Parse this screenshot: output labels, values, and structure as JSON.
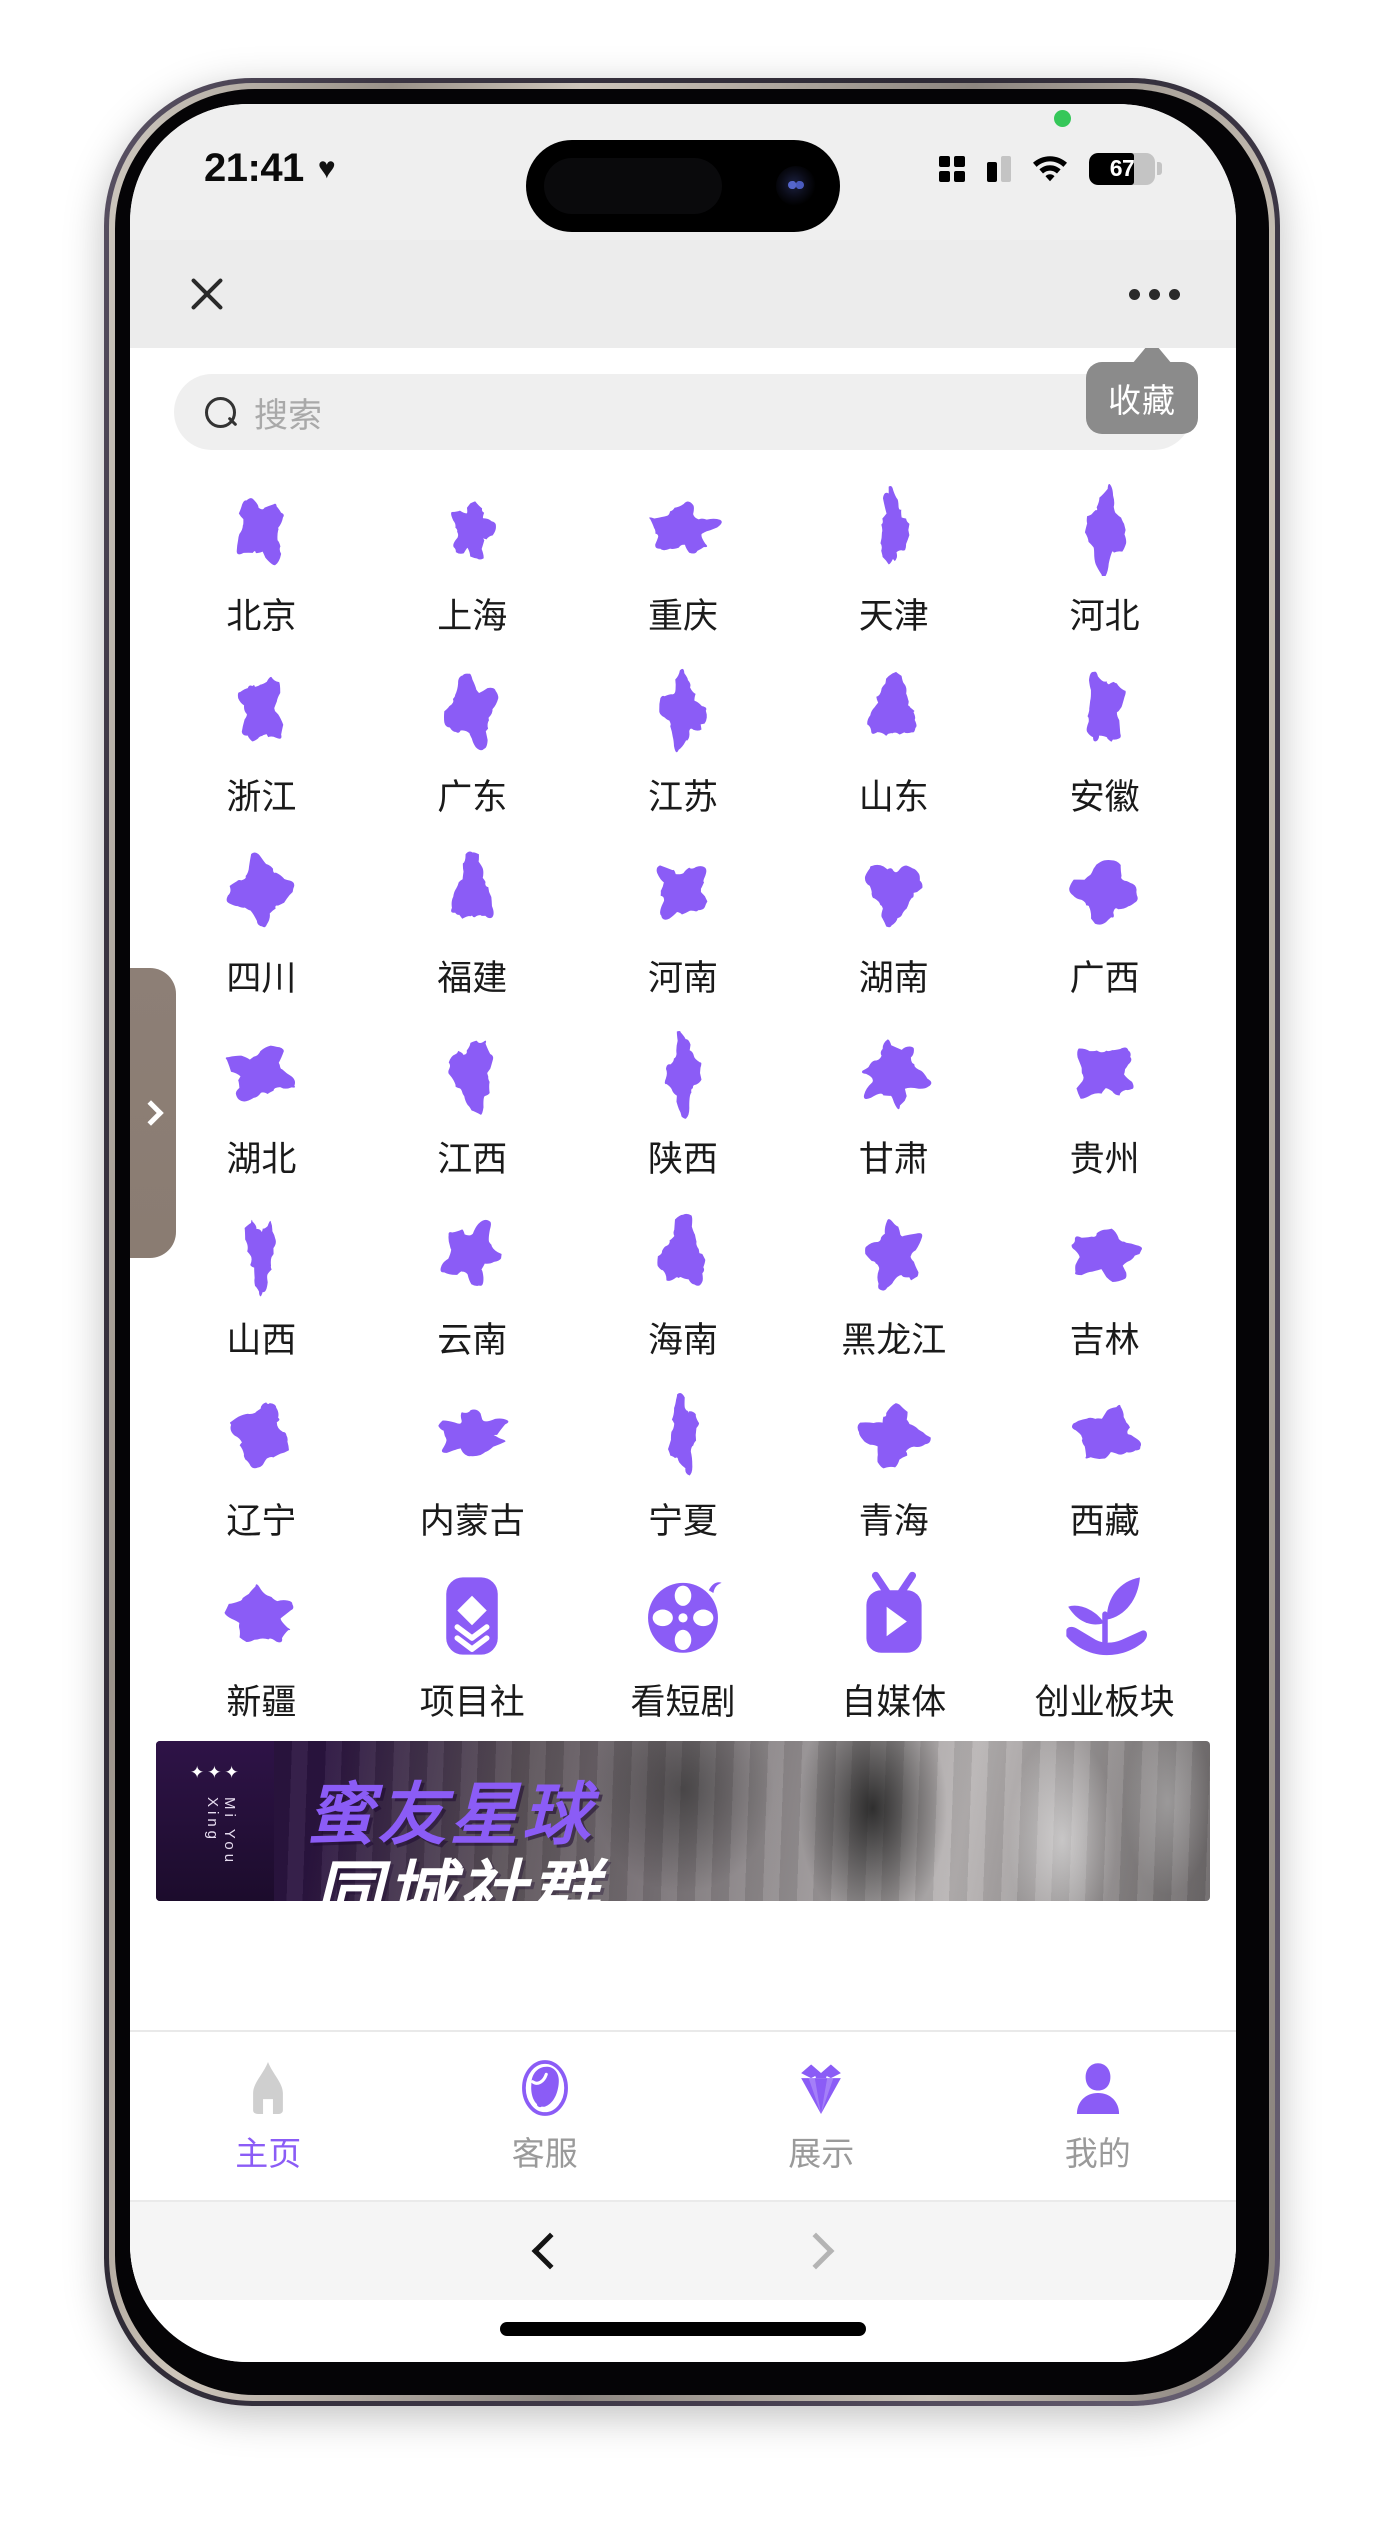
{
  "status_bar": {
    "time": "21:41",
    "heart_icon": "heart-icon",
    "battery_percent": "67",
    "signal_icon": "cellular-signal-icon",
    "wifi_icon": "wifi-icon",
    "recording_dot": "green-recording-dot"
  },
  "header": {
    "close_icon": "close-icon",
    "more_icon": "more-options-icon"
  },
  "search": {
    "placeholder": "搜索",
    "value": "",
    "icon": "search-icon"
  },
  "tooltip": {
    "label": "收藏"
  },
  "drawer": {
    "chevron_icon": "chevron-right-icon"
  },
  "grid": {
    "items": [
      {
        "label": "北京",
        "icon": "map-beijing"
      },
      {
        "label": "上海",
        "icon": "map-shanghai"
      },
      {
        "label": "重庆",
        "icon": "map-chongqing"
      },
      {
        "label": "天津",
        "icon": "map-tianjin"
      },
      {
        "label": "河北",
        "icon": "map-hebei"
      },
      {
        "label": "浙江",
        "icon": "map-zhejiang"
      },
      {
        "label": "广东",
        "icon": "map-guangdong"
      },
      {
        "label": "江苏",
        "icon": "map-jiangsu"
      },
      {
        "label": "山东",
        "icon": "map-shandong"
      },
      {
        "label": "安徽",
        "icon": "map-anhui"
      },
      {
        "label": "四川",
        "icon": "map-sichuan"
      },
      {
        "label": "福建",
        "icon": "map-fujian"
      },
      {
        "label": "河南",
        "icon": "map-henan"
      },
      {
        "label": "湖南",
        "icon": "map-hunan"
      },
      {
        "label": "广西",
        "icon": "map-guangxi"
      },
      {
        "label": "湖北",
        "icon": "map-hubei"
      },
      {
        "label": "江西",
        "icon": "map-jiangxi"
      },
      {
        "label": "陕西",
        "icon": "map-shaanxi"
      },
      {
        "label": "甘肃",
        "icon": "map-gansu"
      },
      {
        "label": "贵州",
        "icon": "map-guizhou"
      },
      {
        "label": "山西",
        "icon": "map-shanxi"
      },
      {
        "label": "云南",
        "icon": "map-yunnan"
      },
      {
        "label": "海南",
        "icon": "map-hainan"
      },
      {
        "label": "黑龙江",
        "icon": "map-heilongjiang"
      },
      {
        "label": "吉林",
        "icon": "map-jilin"
      },
      {
        "label": "辽宁",
        "icon": "map-liaoning"
      },
      {
        "label": "内蒙古",
        "icon": "map-neimenggu"
      },
      {
        "label": "宁夏",
        "icon": "map-ningxia"
      },
      {
        "label": "青海",
        "icon": "map-qinghai"
      },
      {
        "label": "西藏",
        "icon": "map-xizang"
      },
      {
        "label": "新疆",
        "icon": "map-xinjiang"
      },
      {
        "label": "项目社",
        "icon": "layers-icon"
      },
      {
        "label": "看短剧",
        "icon": "film-reel-icon"
      },
      {
        "label": "自媒体",
        "icon": "tv-play-icon"
      },
      {
        "label": "创业板块",
        "icon": "hand-plant-icon"
      }
    ]
  },
  "banner": {
    "sparkles": "✦✦✦",
    "vertical_text": "Mi You Xing",
    "title": "蜜友星球",
    "subtitle": "同城社群"
  },
  "tab_bar": {
    "items": [
      {
        "label": "主页",
        "icon": "home-icon",
        "active": true
      },
      {
        "label": "客服",
        "icon": "headset-icon",
        "active": false
      },
      {
        "label": "展示",
        "icon": "diamond-icon",
        "active": false
      },
      {
        "label": "我的",
        "icon": "person-icon",
        "active": false
      }
    ]
  },
  "browser_nav": {
    "back_icon": "chevron-left-icon",
    "forward_icon": "chevron-right-icon"
  },
  "colors": {
    "accent_purple": "#8b5cf6",
    "tooltip_gray": "#8b8b8b",
    "drawer_brown": "#8d7f76",
    "header_gray": "#ececec",
    "search_gray": "#efefef"
  }
}
